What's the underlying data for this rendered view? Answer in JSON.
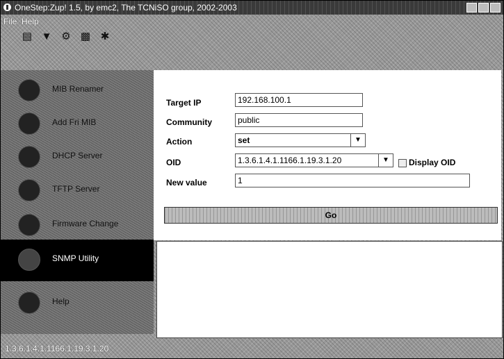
{
  "window": {
    "title": "OneStep:Zup! 1.5, by emc2, The TCNiSO group, 2002-2003"
  },
  "menubar": {
    "items": [
      "File",
      "Help"
    ]
  },
  "toolbar": {
    "icons": [
      "document-icon",
      "funnel-icon",
      "gear-icon",
      "tower-icon",
      "bug-icon"
    ]
  },
  "sidebar": {
    "items": [
      {
        "label": "MIB Renamer",
        "icon": "renamer-icon"
      },
      {
        "label": "Add Fri MIB",
        "icon": "mib-icon"
      },
      {
        "label": "DHCP Server",
        "icon": "dhcp-server-icon"
      },
      {
        "label": "TFTP Server",
        "icon": "tftp-server-icon"
      },
      {
        "label": "Firmware Change",
        "icon": "firmware-icon"
      },
      {
        "label": "SNMP Utility",
        "icon": "snmp-utility-icon"
      },
      {
        "label": "Help",
        "icon": "help-icon"
      }
    ],
    "active_index": 5
  },
  "form": {
    "target_ip_label": "Target IP",
    "target_ip_value": "192.168.100.1",
    "community_label": "Community",
    "community_value": "public",
    "action_label": "Action",
    "action_value": "set",
    "oid_label": "OID",
    "oid_value": "1.3.6.1.4.1.1166.1.19.3.1.20",
    "display_oid_label": "Display OID",
    "new_value_label": "New value",
    "new_value_value": "1",
    "go_label": "Go"
  },
  "status": {
    "text": "1.3.6.1.4.1.1166.1.19.3.1.20"
  }
}
